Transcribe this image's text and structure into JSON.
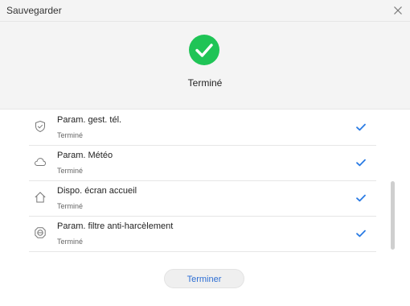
{
  "window": {
    "title": "Sauvegarder"
  },
  "header": {
    "status_text": "Terminé",
    "status_icon": "success-check-icon",
    "accent_color": "#1fc456"
  },
  "items": [
    {
      "label": "Param. gest. tél.",
      "status": "Terminé",
      "icon": "shield-icon"
    },
    {
      "label": "Param. Météo",
      "status": "Terminé",
      "icon": "cloud-icon"
    },
    {
      "label": "Dispo. écran accueil",
      "status": "Terminé",
      "icon": "home-icon"
    },
    {
      "label": "Param. filtre anti-harcèlement",
      "status": "Terminé",
      "icon": "filter-icon"
    }
  ],
  "check_color": "#2a7be4",
  "footer": {
    "button_label": "Terminer",
    "button_color": "#2e6fd4"
  }
}
